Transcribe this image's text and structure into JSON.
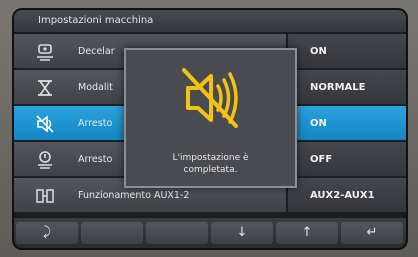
{
  "titlebar": {
    "title": "Impostazioni macchina"
  },
  "colors": {
    "accent": "#1a93d1",
    "warning": "#f2c40f"
  },
  "rows": [
    {
      "icon": "deceleration-icon",
      "label": "Decelar",
      "value": "ON",
      "selected": false
    },
    {
      "icon": "mode-icon",
      "label": "Modalit",
      "value": "NORMALE",
      "selected": false
    },
    {
      "icon": "mute-icon",
      "label": "Arresto",
      "value": "ON",
      "selected": true
    },
    {
      "icon": "engine-stop-icon",
      "label": "Arresto",
      "value": "OFF",
      "selected": false
    },
    {
      "icon": "aux-icon",
      "label": "Funzionamento AUX1-2",
      "value": "AUX2-AUX1",
      "selected": false
    }
  ],
  "bottom_keys": [
    {
      "icon": "back-icon",
      "glyph": "⤸"
    },
    {
      "icon": "blank-key",
      "glyph": ""
    },
    {
      "icon": "blank-key",
      "glyph": ""
    },
    {
      "icon": "arrow-down-icon",
      "glyph": "↓"
    },
    {
      "icon": "arrow-up-icon",
      "glyph": "↑"
    },
    {
      "icon": "enter-icon",
      "glyph": "↵"
    }
  ],
  "popup": {
    "icon": "mute-speaker-icon",
    "message_line1": "L'impostazione è",
    "message_line2": "completata."
  }
}
